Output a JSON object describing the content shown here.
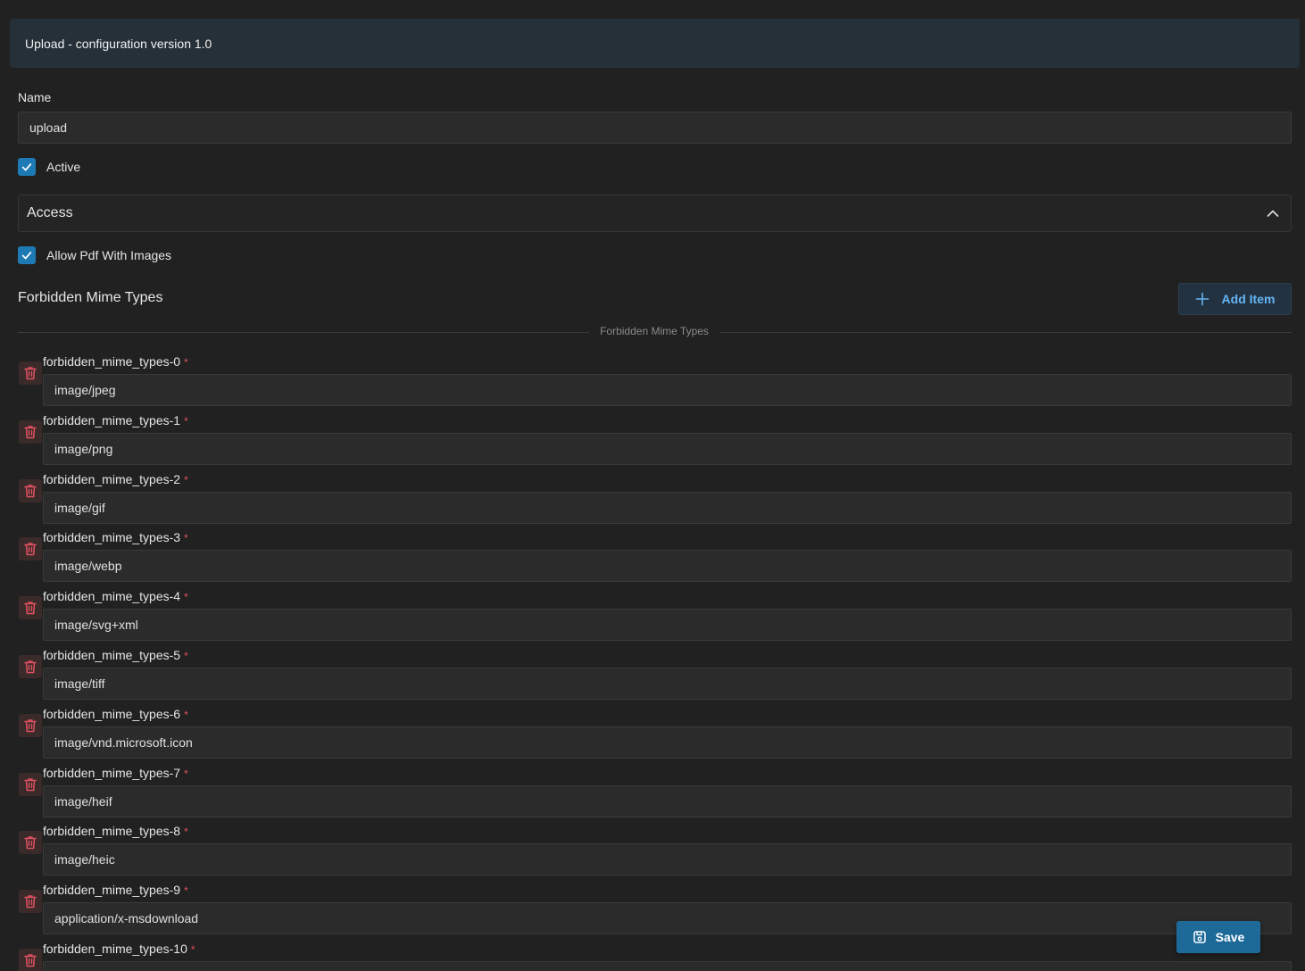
{
  "header": {
    "title": "Upload - configuration version 1.0"
  },
  "name_field": {
    "label": "Name",
    "value": "upload"
  },
  "active": {
    "label": "Active",
    "checked": true
  },
  "access": {
    "title": "Access",
    "expanded": true
  },
  "allow_pdf": {
    "label": "Allow Pdf With Images",
    "checked": true
  },
  "forbidden": {
    "section_title": "Forbidden Mime Types",
    "add_label": "Add Item",
    "divider_label": "Forbidden Mime Types",
    "required_mark": "*",
    "items": [
      {
        "label": "forbidden_mime_types-0",
        "value": "image/jpeg"
      },
      {
        "label": "forbidden_mime_types-1",
        "value": "image/png"
      },
      {
        "label": "forbidden_mime_types-2",
        "value": "image/gif"
      },
      {
        "label": "forbidden_mime_types-3",
        "value": "image/webp"
      },
      {
        "label": "forbidden_mime_types-4",
        "value": "image/svg+xml"
      },
      {
        "label": "forbidden_mime_types-5",
        "value": "image/tiff"
      },
      {
        "label": "forbidden_mime_types-6",
        "value": "image/vnd.microsoft.icon"
      },
      {
        "label": "forbidden_mime_types-7",
        "value": "image/heif"
      },
      {
        "label": "forbidden_mime_types-8",
        "value": "image/heic"
      },
      {
        "label": "forbidden_mime_types-9",
        "value": "application/x-msdownload"
      },
      {
        "label": "forbidden_mime_types-10",
        "value": ""
      }
    ]
  },
  "save": {
    "label": "Save"
  },
  "colors": {
    "accent": "#1d7ab5",
    "danger": "#e05260",
    "background": "#212121"
  }
}
